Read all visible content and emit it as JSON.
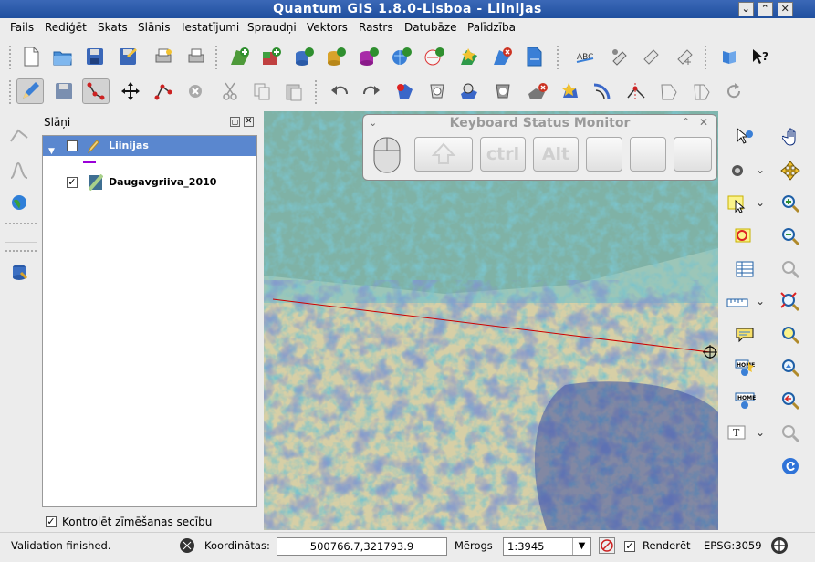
{
  "window": {
    "title": "Quantum GIS 1.8.0-Lisboa - Liinijas",
    "buttons": [
      "⌄",
      "⌃",
      "✕"
    ]
  },
  "menu": [
    "Fails",
    "Rediģēt",
    "Skats",
    "Slānis",
    "Iestatījumi",
    "Spraudņi",
    "Vektors",
    "Rastrs",
    "Datubāze",
    "Palīdzība"
  ],
  "layers_panel": {
    "title": "Slāņi",
    "layers": [
      {
        "name": "Liinijas",
        "checked": true,
        "selected": true,
        "swatch": "#9a00d8"
      },
      {
        "name": "Daugavgriiva_2010",
        "checked": true,
        "selected": false
      }
    ],
    "render_order_label": "Kontrolēt zīmēšanas secību",
    "render_order_checked": true
  },
  "keyboard_monitor": {
    "title": "Keyboard Status Monitor",
    "keys": [
      "",
      "ctrl",
      "Alt",
      "",
      "",
      ""
    ]
  },
  "statusbar": {
    "message": "Validation finished.",
    "coords_label": "Koordinātas:",
    "coords_value": "500766.7,321793.9",
    "scale_label": "Mērogs",
    "scale_value": "1:3945",
    "render_label": "Renderēt",
    "render_checked": true,
    "crs": "EPSG:3059"
  },
  "colors": {
    "titlebar": "#2a5aa8",
    "selection": "#5a87cf",
    "line_feature": "#cc0000"
  }
}
